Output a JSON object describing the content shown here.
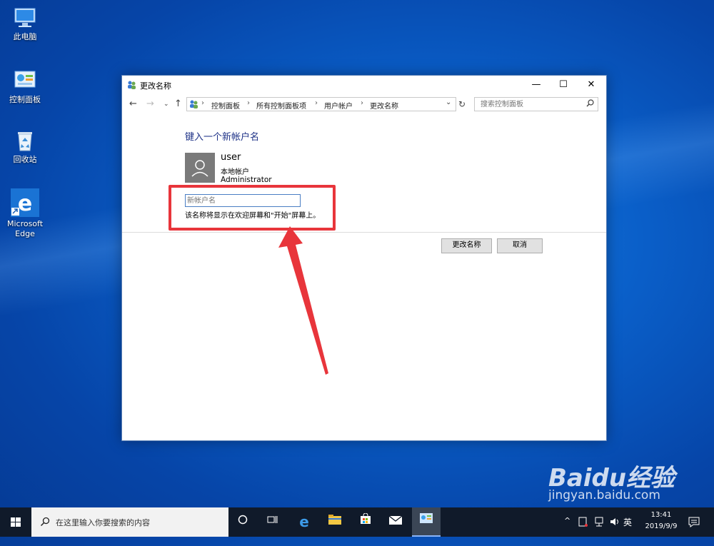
{
  "desktop": {
    "icons": [
      {
        "label": "此电脑"
      },
      {
        "label": "控制面板"
      },
      {
        "label": "回收站"
      },
      {
        "label": "Microsoft Edge"
      }
    ]
  },
  "window": {
    "title": "更改名称",
    "controls": {
      "minimize": "—",
      "maximize": "☐",
      "close": "✕"
    },
    "breadcrumbs": [
      "控制面板",
      "所有控制面板项",
      "用户帐户",
      "更改名称"
    ],
    "search_placeholder": "搜索控制面板",
    "heading": "键入一个新帐户名",
    "user": {
      "name": "user",
      "type": "本地帐户",
      "role": "Administrator"
    },
    "new_name_placeholder": "新帐户名",
    "hint": "该名称将显示在欢迎屏幕和\"开始\"屏幕上。",
    "buttons": {
      "rename": "更改名称",
      "cancel": "取消"
    }
  },
  "taskbar": {
    "search_text": "在这里输入你要搜索的内容",
    "tray": {
      "ime": "英",
      "time": "13:41",
      "date": "2019/9/9"
    }
  },
  "watermark": {
    "logo": "Baidu经验",
    "url": "jingyan.baidu.com"
  },
  "colors": {
    "accent": "#1e3287",
    "highlight": "#e8353b",
    "taskbar": "#101a2a"
  }
}
